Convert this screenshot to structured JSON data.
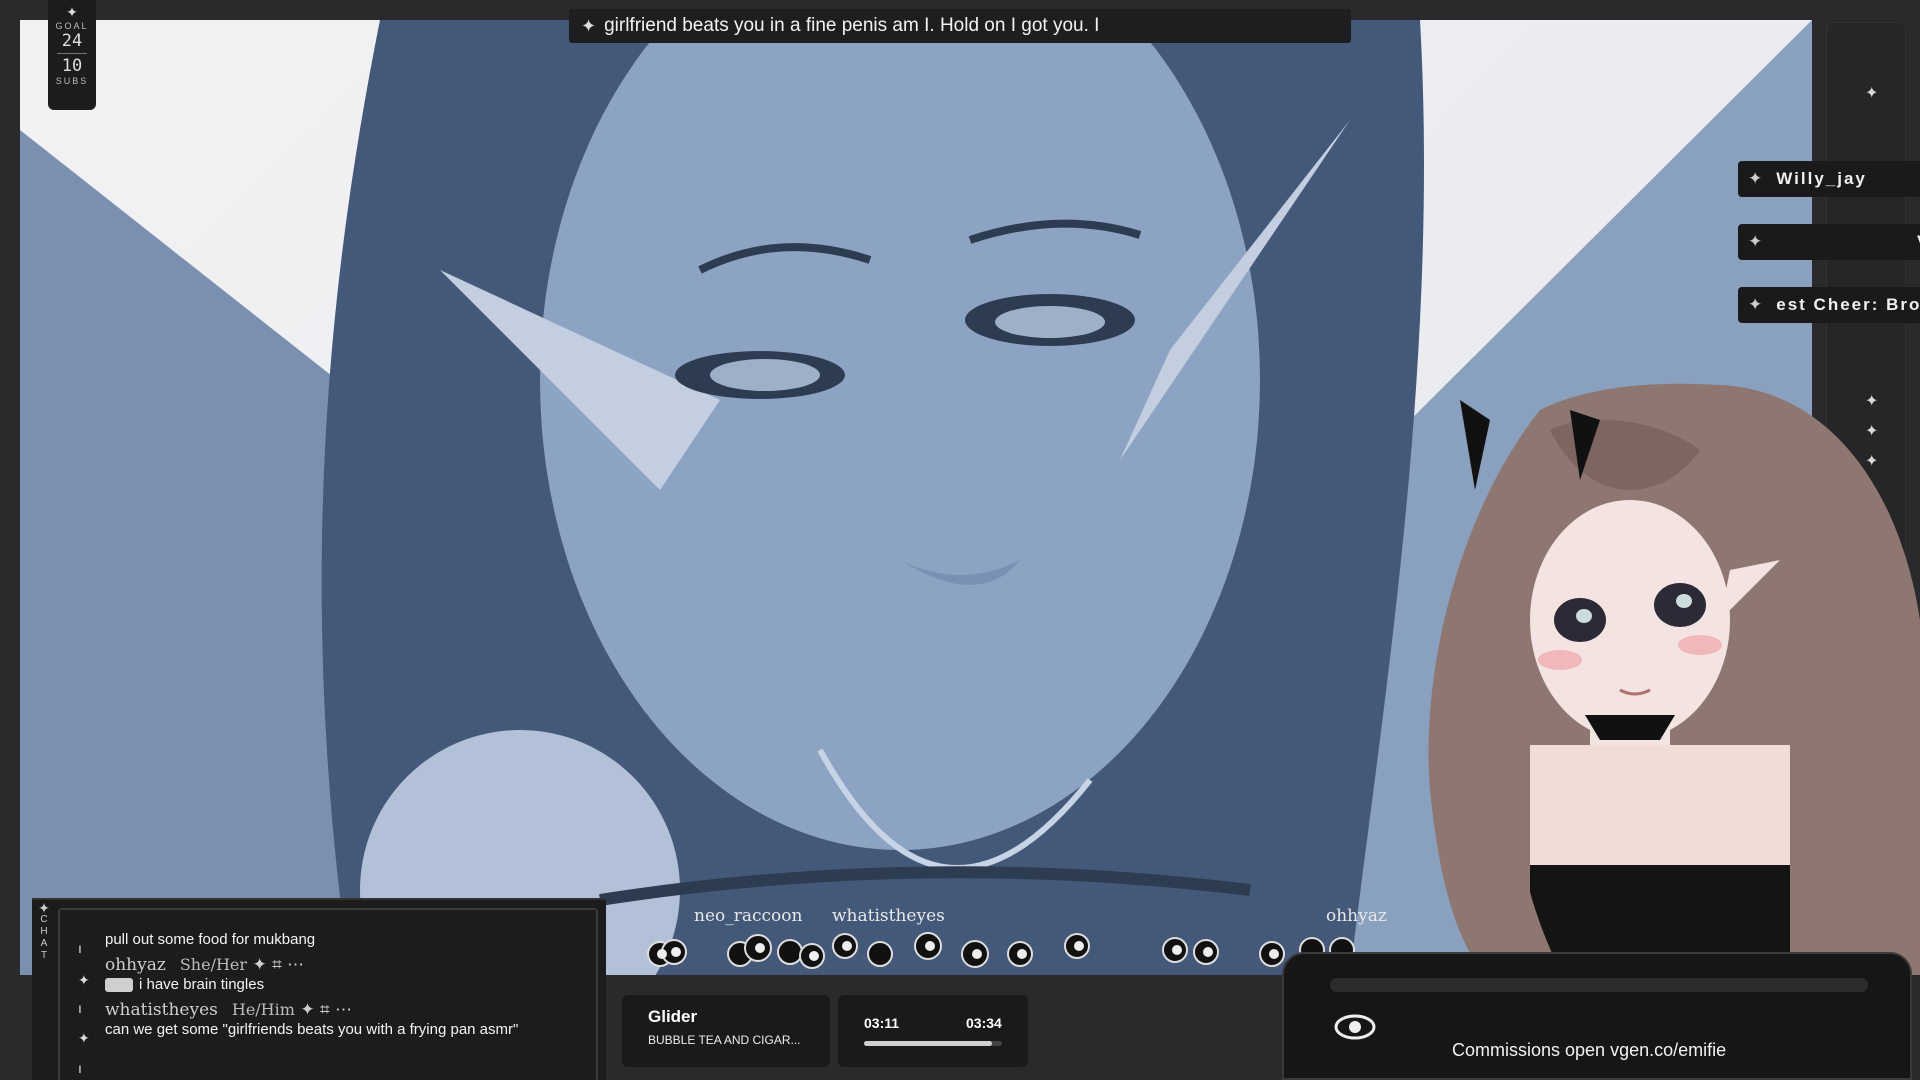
{
  "goal": {
    "label_top": "GOAL",
    "current": "24",
    "target": "10",
    "label_bottom": "SUBS"
  },
  "caption": {
    "text": "girlfriend beats you in a fine penis am I. Hold on I got you. I"
  },
  "tags": [
    {
      "label": "Willy_jay"
    },
    {
      "label": "Vr"
    },
    {
      "label": "est Cheer: Brol"
    }
  ],
  "chat": {
    "side_label": [
      "C",
      "H",
      "A",
      "T"
    ],
    "messages": [
      {
        "text": "pull out some food for mukbang"
      },
      {
        "user": "ohhyaz",
        "pronoun": "She/Her",
        "text": "i have brain tingles"
      },
      {
        "user": "whatistheyes",
        "pronoun": "He/Him",
        "text": "can we get some \"girlfriends beats you with a frying pan asmr\""
      }
    ]
  },
  "critter_names": [
    "neo_raccoon",
    "whatistheyes",
    "ohhyaz"
  ],
  "now_playing": {
    "title": "Glider",
    "artist": "BUBBLE TEA AND CIGAR..."
  },
  "timer": {
    "elapsed": "03:11",
    "total": "03:34",
    "progress": 0.93
  },
  "commissions": {
    "text": "Commissions open vgen.co/emifie"
  },
  "colors": {
    "accent": "#1c1c1e",
    "scene_tint": "#6f85a5"
  }
}
